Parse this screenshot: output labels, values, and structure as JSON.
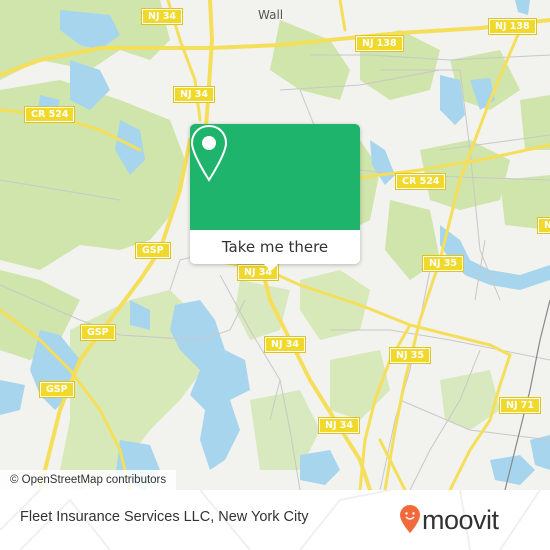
{
  "map": {
    "place_labels": [
      {
        "id": "wall",
        "text": "Wall"
      }
    ],
    "road_shields": [
      {
        "id": "nj34-top",
        "text": "NJ 34"
      },
      {
        "id": "nj34-upper",
        "text": "NJ 34"
      },
      {
        "id": "nj138-left",
        "text": "NJ 138"
      },
      {
        "id": "nj138-right",
        "text": "NJ 138"
      },
      {
        "id": "cr524-left",
        "text": "CR 524"
      },
      {
        "id": "cr524-right",
        "text": "CR 524"
      },
      {
        "id": "gsp-upper",
        "text": "GSP"
      },
      {
        "id": "gsp-middle",
        "text": "GSP"
      },
      {
        "id": "gsp-lower",
        "text": "GSP"
      },
      {
        "id": "nj34-popup",
        "text": "NJ 34"
      },
      {
        "id": "nj34-mid",
        "text": "NJ 34"
      },
      {
        "id": "nj34-lower",
        "text": "NJ 34"
      },
      {
        "id": "nj35-upper",
        "text": "NJ 35"
      },
      {
        "id": "nj35-lower",
        "text": "NJ 35"
      },
      {
        "id": "nj71",
        "text": "NJ 71"
      },
      {
        "id": "nj-edge",
        "text": "NJ"
      }
    ],
    "colors": {
      "land": "#f2f2ee",
      "park": "#cfe5ab",
      "water": "#a7d5ee",
      "road_major": "#f5df5a",
      "road_minor": "#c8c8c8",
      "shield": "#f1d92b"
    }
  },
  "popup": {
    "pin_icon": "map-pin-icon",
    "button_label": "Take me there",
    "color": "#1fb46b"
  },
  "attribution": {
    "text": "© OpenStreetMap contributors"
  },
  "footer": {
    "title": "Fleet Insurance Services LLC, New York City",
    "logo_text": "moovit",
    "logo_color": "#f26a3b"
  }
}
